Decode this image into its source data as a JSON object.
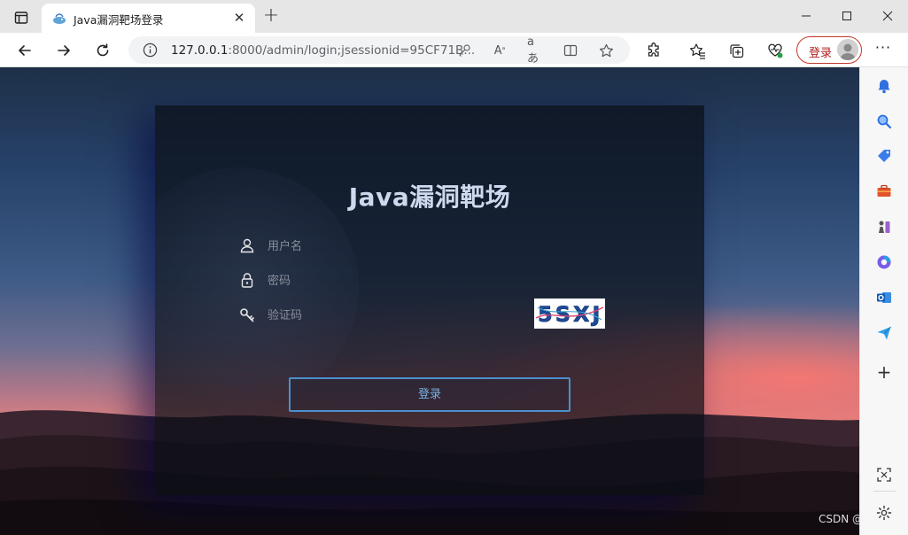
{
  "browser": {
    "tab": {
      "title": "Java漏洞靶场登录"
    },
    "address_bar": {
      "host": "127.0.0.1",
      "rest": ":8000/admin/login;jsessionid=95CF71B..."
    },
    "profile_button": {
      "label": "登录"
    },
    "colors": {
      "accent": "#b0201e",
      "tab_strip": "#e6e6e6"
    }
  },
  "page": {
    "title": "Java漏洞靶场",
    "form": {
      "username_placeholder": "用户名",
      "password_placeholder": "密码",
      "captcha_placeholder": "验证码",
      "captcha_text": "5SXJ",
      "submit_label": "登录"
    }
  },
  "watermark": "CSDN @lleolly",
  "icons": [
    "sidebar-toggle-icon",
    "close-icon",
    "plus-icon",
    "minimize-icon",
    "maximize-icon",
    "back-icon",
    "forward-icon",
    "refresh-icon",
    "info-icon",
    "key-icon",
    "read-aloud-icon",
    "translate-icon",
    "split-screen-icon",
    "favorite-star-icon",
    "extensions-icon",
    "favorites-icon",
    "collections-icon",
    "health-icon",
    "more-icon",
    "bell-icon",
    "search-icon",
    "tag-icon",
    "toolbox-icon",
    "chess-icon",
    "office-icon",
    "outlook-icon",
    "send-icon",
    "add-icon",
    "screenshot-icon",
    "settings-icon",
    "user-icon",
    "lock-icon"
  ]
}
